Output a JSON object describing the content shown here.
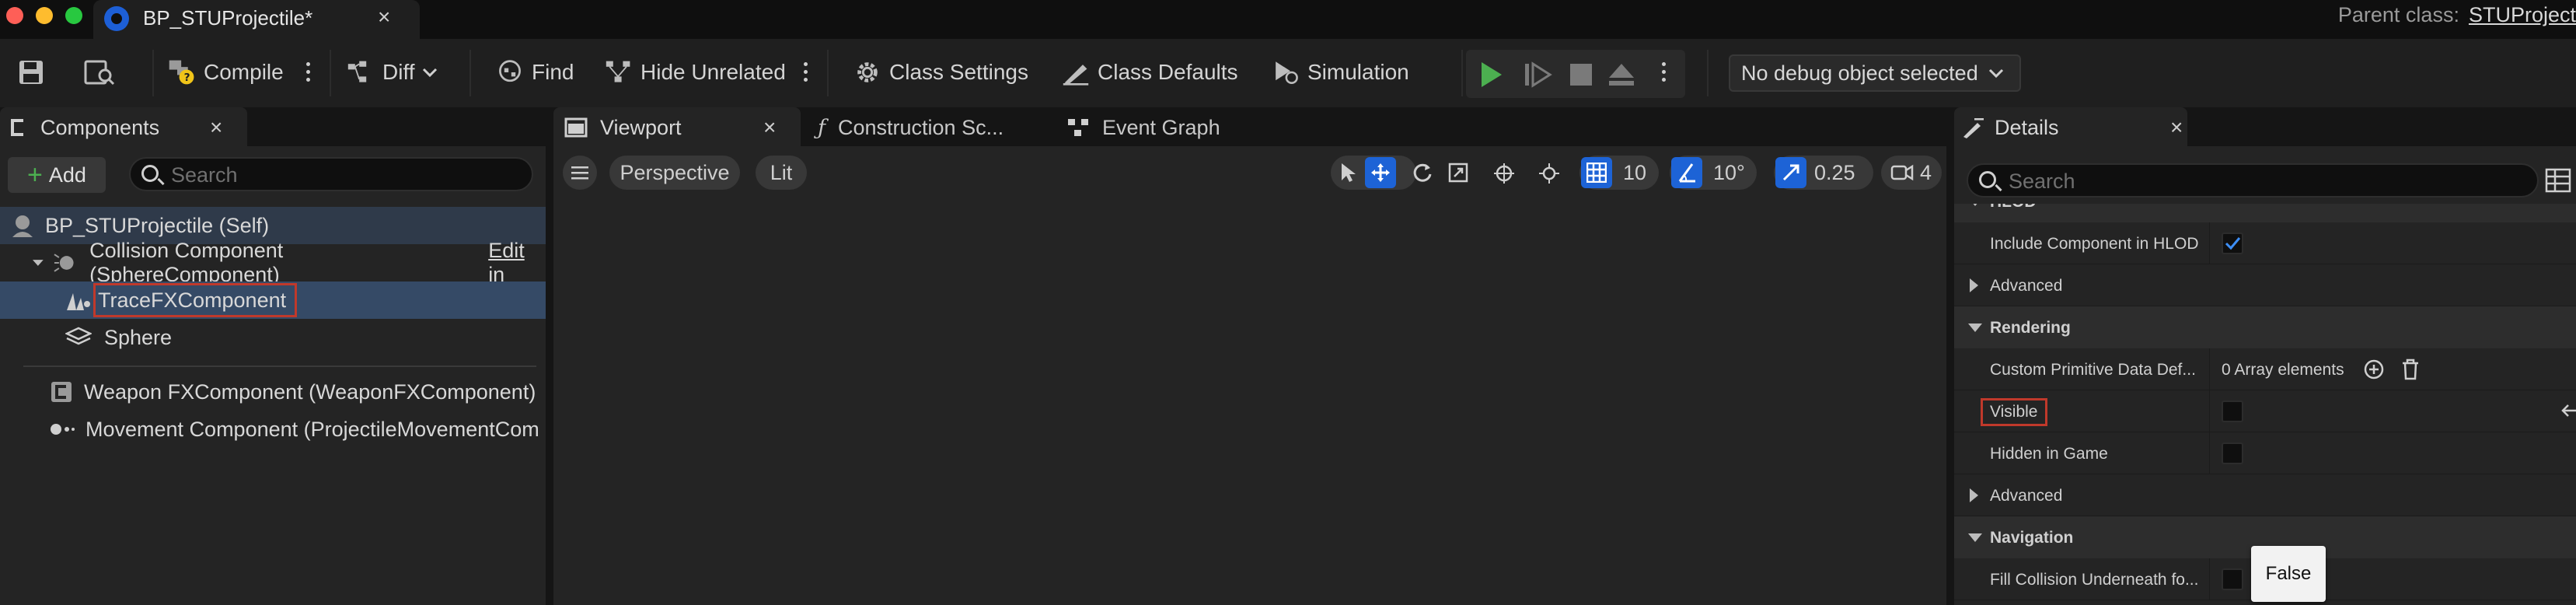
{
  "titlebar": {
    "tab_title": "BP_STUProjectile*",
    "tab_close": "×",
    "parent_class_label": "Parent class:",
    "parent_class_value": "STUProject"
  },
  "toolbar": {
    "compile": "Compile",
    "diff": "Diff",
    "find": "Find",
    "hide_unrelated": "Hide Unrelated",
    "class_settings": "Class Settings",
    "class_defaults": "Class Defaults",
    "simulation": "Simulation",
    "debug_object": "No debug object selected"
  },
  "components": {
    "tab_label": "Components",
    "close": "×",
    "add_label": "Add",
    "search_placeholder": "Search",
    "tree": [
      {
        "label": "BP_STUProjectile (Self)"
      },
      {
        "label": "Collision Component (SphereComponent)",
        "extra": "Edit in"
      },
      {
        "label": "TraceFXComponent"
      },
      {
        "label": "Sphere"
      },
      {
        "label": "Weapon FXComponent (WeaponFXComponent)"
      },
      {
        "label": "Movement Component (ProjectileMovementCom"
      }
    ]
  },
  "viewport": {
    "tabs": [
      {
        "label": "Viewport",
        "close": "×"
      },
      {
        "label": "Construction Sc..."
      },
      {
        "label": "Event Graph"
      }
    ],
    "perspective": "Perspective",
    "lit": "Lit",
    "grid_value": "10",
    "angle_value": "10°",
    "scale_value": "0.25",
    "camera_value": "4"
  },
  "details": {
    "tab_label": "Details",
    "close": "×",
    "search_placeholder": "Search",
    "rows": {
      "hlod_cat": "HLOD",
      "include_hlod": "Include Component in HLOD",
      "advanced1": "Advanced",
      "rendering_cat": "Rendering",
      "custom_prim": "Custom Primitive Data Def...",
      "array_elements": "0 Array elements",
      "visible": "Visible",
      "hidden_in_game": "Hidden in Game",
      "advanced2": "Advanced",
      "navigation_cat": "Navigation",
      "fill_collision": "Fill Collision Underneath fo..."
    },
    "tooltip": "False"
  },
  "colors": {
    "accent_blue": "#1d63d6",
    "play_green": "#4caf50",
    "highlight_red": "#c0392b",
    "selection": "#354a66"
  }
}
